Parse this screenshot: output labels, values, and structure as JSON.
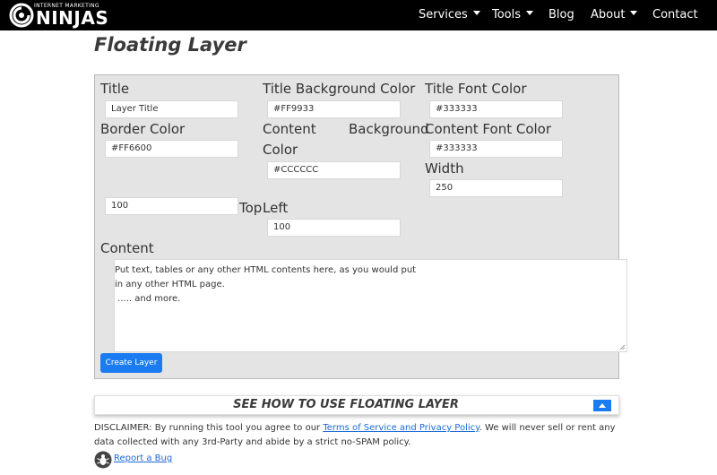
{
  "nav": {
    "logo_tagline": "INTERNET MARKETING",
    "logo_brand": "NINJAS",
    "items": [
      {
        "label": "Services",
        "dropdown": true
      },
      {
        "label": "Tools",
        "dropdown": true
      },
      {
        "label": "Blog",
        "dropdown": false
      },
      {
        "label": "About",
        "dropdown": true
      },
      {
        "label": "Contact",
        "dropdown": false
      }
    ]
  },
  "page": {
    "title": "Floating Layer"
  },
  "form": {
    "title_label": "Title",
    "title_value": "Layer Title",
    "title_bg_label": "Title Background Color",
    "title_bg_value": "#FF9933",
    "title_font_label": "Title Font Color",
    "title_font_value": "#333333",
    "border_label": "Border Color",
    "border_value": "#FF6600",
    "content_bg_label_1": "Content",
    "content_bg_label_2": "Background",
    "content_bg_label_3": "Color",
    "content_bg_value": "#CCCCCC",
    "content_font_label": "Content Font Color",
    "content_font_value": "#333333",
    "width_label": "Width",
    "width_value": "250",
    "top_value": "100",
    "top_label": "Top",
    "left_label": "Left",
    "left_value": "100",
    "content_label": "Content",
    "content_lines": [
      "Put text, tables or any other HTML contents here, as you would put",
      "in any other HTML page.",
      " ..... and more."
    ],
    "create_button": "Create Layer"
  },
  "howto": {
    "text": "SEE HOW TO USE FLOATING LAYER"
  },
  "disclaimer": {
    "text_before": "DISCLAIMER: By running this tool you agree to our ",
    "link_text": "Terms of Service and Privacy Policy",
    "text_after": ". We will never sell or rent any data collected with any 3rd-Party and abide by a strict no-SPAM policy."
  },
  "report_bug": {
    "label": "Report a Bug"
  },
  "colors": {
    "nav_bg": "#000000",
    "accent": "#1a7cf0",
    "panel_bg": "#e4e4e4"
  }
}
